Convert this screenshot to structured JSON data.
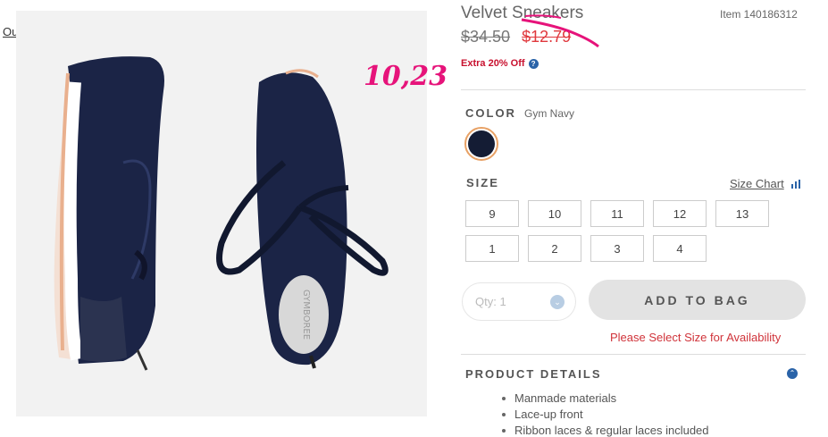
{
  "outfit_link": "Outfit This",
  "annotation": {
    "handwritten_price": "10,23"
  },
  "product": {
    "title": "Velvet Sneakers",
    "item_number": "Item 140186312",
    "old_price": "$34.50",
    "sale_price": "$12.79",
    "promo": "Extra 20% Off",
    "help_icon": "?"
  },
  "color": {
    "label": "COLOR",
    "selected": "Gym Navy",
    "swatch_hex": "#141c34"
  },
  "size": {
    "label": "SIZE",
    "chart_link": "Size Chart",
    "options": [
      "9",
      "10",
      "11",
      "12",
      "13",
      "1",
      "2",
      "3",
      "4"
    ]
  },
  "purchase": {
    "qty_label": "Qty: 1",
    "qty_arrow": "⌄",
    "add_to_bag": "ADD TO BAG",
    "warning": "Please Select Size for Availability"
  },
  "details": {
    "label": "PRODUCT DETAILS",
    "expand_icon": "⌃",
    "items": [
      "Manmade materials",
      "Lace-up front",
      "Ribbon laces & regular laces included"
    ]
  },
  "image": {
    "insole_text": "GYMBOREE"
  },
  "colors": {
    "accent_red": "#e0383d",
    "annotation_pink": "#e6137a",
    "brand_blue": "#2a63a8"
  }
}
